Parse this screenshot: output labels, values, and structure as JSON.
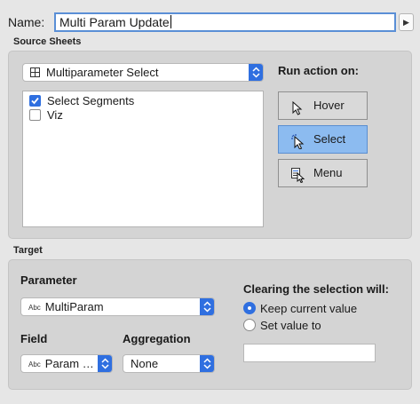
{
  "name_row": {
    "label": "Name:",
    "value": "Multi Param Update"
  },
  "source": {
    "title": "Source Sheets",
    "sheet_select": "Multiparameter Select",
    "sheets": [
      {
        "label": "Select Segments",
        "checked": true
      },
      {
        "label": "Viz",
        "checked": false
      }
    ],
    "run_action_label": "Run action on:",
    "actions": [
      {
        "label": "Hover",
        "icon": "pointer-icon",
        "selected": false
      },
      {
        "label": "Select",
        "icon": "click-pointer-icon",
        "selected": true
      },
      {
        "label": "Menu",
        "icon": "menu-pointer-icon",
        "selected": false
      }
    ]
  },
  "target": {
    "title": "Target",
    "parameter_label": "Parameter",
    "parameter_abc": "Abc",
    "parameter_value": "MultiParam",
    "field_label": "Field",
    "field_abc": "Abc",
    "field_value": "Param …",
    "aggregation_label": "Aggregation",
    "aggregation_value": "None",
    "clearing_label": "Clearing the selection will:",
    "clearing_options": [
      {
        "label": "Keep current value",
        "selected": true
      },
      {
        "label": "Set value to",
        "selected": false
      }
    ],
    "set_value": ""
  },
  "colors": {
    "accent": "#2f6fe0",
    "selected_button": "#8cbbf0",
    "panel": "#d4d4d4",
    "background": "#e6e6e6"
  }
}
